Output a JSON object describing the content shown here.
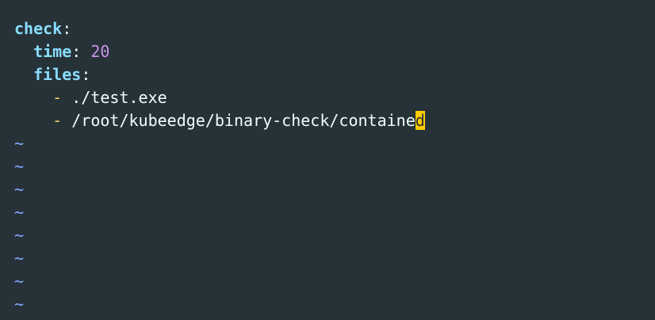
{
  "editor": {
    "lines": [
      {
        "key": "check",
        "sep": ":"
      },
      {
        "indent": "  ",
        "key": "time",
        "sep": ": ",
        "value": "20"
      },
      {
        "indent": "  ",
        "key": "files",
        "sep": ":"
      },
      {
        "indent": "    ",
        "dash": "- ",
        "text": "./test.exe"
      },
      {
        "indent": "    ",
        "dash": "- ",
        "text": "/root/kubeedge/binary-check/containe",
        "cursor_char": "d"
      }
    ],
    "empty_line_marker": "~",
    "empty_lines": [
      "~",
      "~",
      "~",
      "~",
      "~",
      "~",
      "~",
      "~"
    ]
  }
}
